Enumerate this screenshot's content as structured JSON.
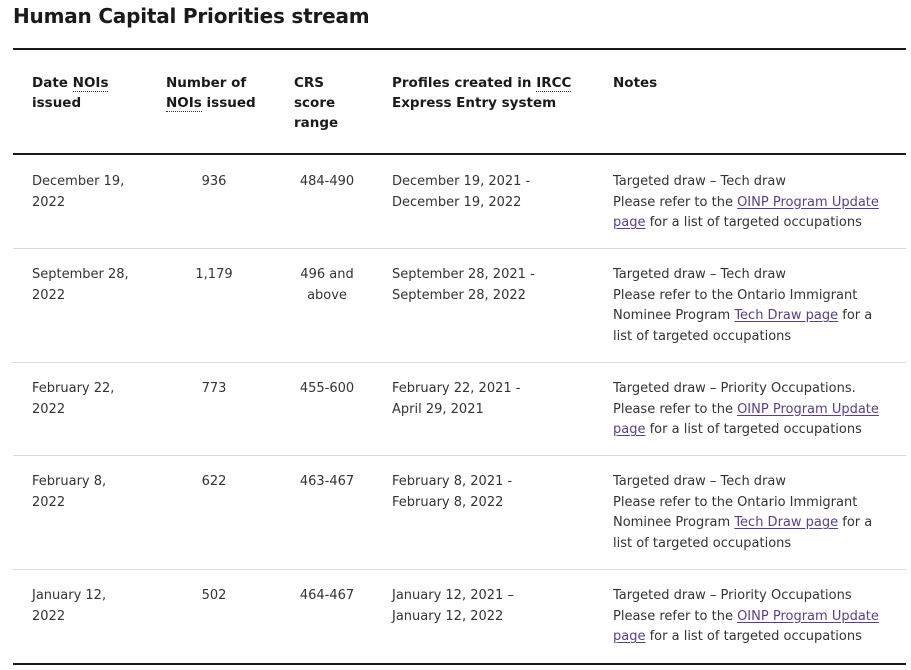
{
  "title": "Human Capital Priorities stream",
  "headers": {
    "date": {
      "abbr": "NOIs",
      "pre": "Date ",
      "post": " issued"
    },
    "number": {
      "pre": "Number of ",
      "abbr": "NOIs",
      "post": " issued"
    },
    "crs": "CRS score range",
    "profiles": {
      "pre": "Profiles created in ",
      "abbr": "IRCC",
      "post": " Express Entry system"
    },
    "notes": "Notes"
  },
  "rows": [
    {
      "date": "December 19, 2022",
      "number": "936",
      "crs": "484-490",
      "profiles": "December 19, 2021 - December 19, 2022",
      "note_line": "Targeted draw – Tech draw",
      "note_pre": "Please refer to the ",
      "note_link": "OINP Program Update page",
      "note_post": " for a list of targeted occupations"
    },
    {
      "date": "September 28, 2022",
      "number": "1,179",
      "crs": "496 and above",
      "profiles": "September 28, 2021 - September 28, 2022",
      "note_line": "Targeted draw – Tech draw",
      "note_pre": "Please refer to the Ontario Immigrant Nominee Program ",
      "note_link": "Tech Draw page",
      "note_post": " for a list of targeted occupations"
    },
    {
      "date": "February 22, 2022",
      "number": "773",
      "crs": "455-600",
      "profiles": "February 22, 2021 - April 29, 2021",
      "note_line": "Targeted draw – Priority Occupations.",
      "note_pre": "Please refer to the ",
      "note_link": "OINP Program Update page",
      "note_post": " for a list of targeted occupations"
    },
    {
      "date": "February 8, 2022",
      "number": "622",
      "crs": "463-467",
      "profiles": "February 8, 2021 - February 8, 2022",
      "note_line": "Targeted draw – Tech draw",
      "note_pre": "Please refer to the Ontario Immigrant Nominee Program ",
      "note_link": "Tech Draw page",
      "note_post": " for a list of targeted occupations"
    },
    {
      "date": "January 12, 2022",
      "number": "502",
      "crs": "464-467",
      "profiles": "January 12, 2021 – January 12, 2022",
      "note_line": "Targeted draw – Priority Occupations",
      "note_pre": "Please refer to the ",
      "note_link": "OINP Program Update page",
      "note_post": " for a list of targeted occupations"
    }
  ]
}
